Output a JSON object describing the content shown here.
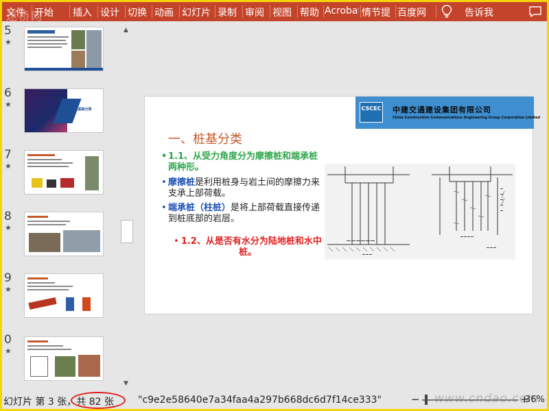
{
  "ribbon": {
    "watermark": "迷桥网",
    "tabs": [
      "文件",
      "开始",
      "插入",
      "设计",
      "切换",
      "动画",
      "幻灯片",
      "录制",
      "审阅",
      "视图",
      "帮助",
      "Acrobat",
      "情节提",
      "百度网"
    ],
    "tell_me": "告诉我",
    "icons": [
      "lightbulb-icon",
      "comment-icon"
    ]
  },
  "thumbnails": [
    {
      "number": "5",
      "star": "★",
      "kind": "photo-layout"
    },
    {
      "number": "6",
      "star": "★",
      "kind": "section-title",
      "title": "2、桩基础分类"
    },
    {
      "number": "7",
      "star": "★",
      "kind": "photo-layout"
    },
    {
      "number": "8",
      "star": "★",
      "kind": "photo-layout"
    },
    {
      "number": "9",
      "star": "★",
      "kind": "photo-layout"
    },
    {
      "number": "0",
      "star": "★",
      "kind": "photo-layout"
    }
  ],
  "slide": {
    "company_cn": "中建交通建设集团有限公司",
    "company_en": "China Construction Communications Engineering Group Corporation Limited",
    "logo_text": "CSCEC",
    "title": "一、桩基分类",
    "bullet1": "1.1、从受力角度分为摩擦桩和端承桩两种形。",
    "bullet2_term": "摩擦桩",
    "bullet2_rest": "是利用桩身与岩土间的摩擦力来支承上部荷载。",
    "bullet3_term": "端承桩（柱桩）",
    "bullet3_rest": "是将上部荷载直接传递到桩底部的岩层。",
    "bullet4": "1.2、从是否有水分为陆地桩和水中桩。",
    "bullet_char": "•",
    "colors": {
      "header": "#3e8ed0",
      "title": "#c55a2a",
      "green": "#2ca64a",
      "blue": "#1c4fb3",
      "red": "#e02020"
    }
  },
  "status": {
    "slide_info": "幻灯片 第 3 张，共 82 张",
    "slide_name": "\"c9e2e58640e7a34faa4a297b668dc6d7f14ce333\"",
    "zoom": "36%",
    "site_watermark": "www.cndao.com"
  }
}
